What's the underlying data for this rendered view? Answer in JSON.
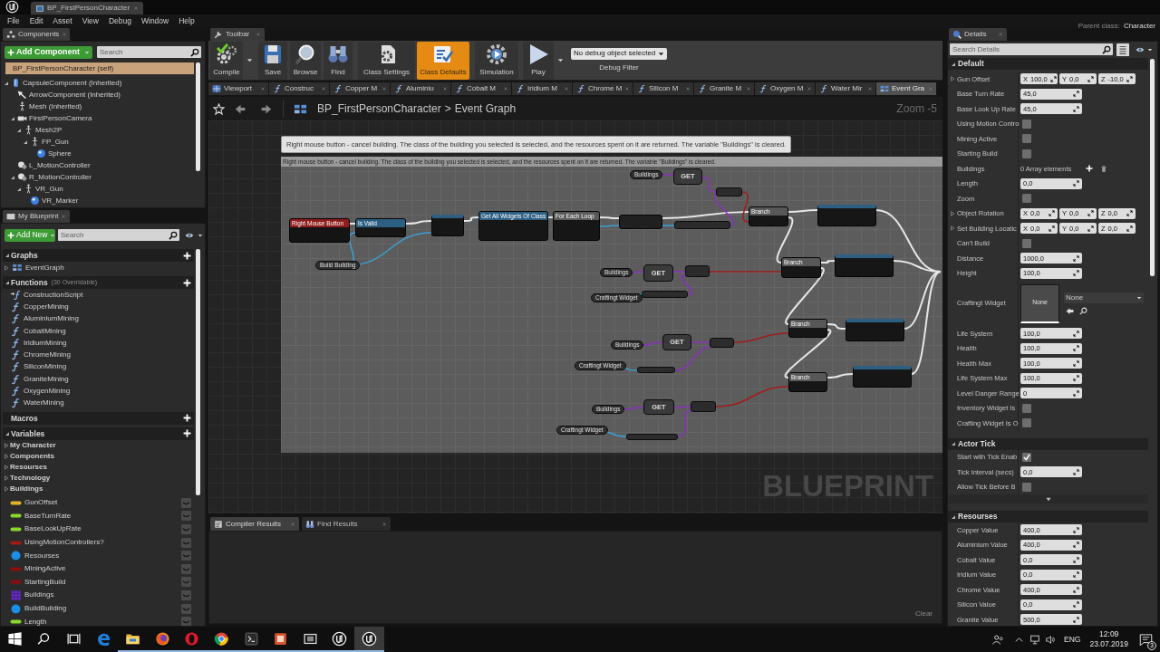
{
  "title_bar": {
    "document_tab": "BP_FirstPersonCharacter",
    "parent_class_label": "Parent class:",
    "parent_class": "Character"
  },
  "menu": [
    "File",
    "Edit",
    "Asset",
    "View",
    "Debug",
    "Window",
    "Help"
  ],
  "components": {
    "tab": "Components",
    "add_button": "Add Component",
    "search": {
      "placeholder": "Search"
    },
    "root": {
      "label": "BP_FirstPersonCharacter (self)",
      "selected": true
    },
    "tree": [
      {
        "label": "CapsuleComponent (Inherited)",
        "kind": "capsule",
        "expanded": true,
        "children": [
          {
            "label": "ArrowComponent (Inherited)",
            "kind": "arrow"
          },
          {
            "label": "Mesh (Inherited)",
            "kind": "mesh"
          },
          {
            "label": "FirstPersonCamera",
            "kind": "camera",
            "expanded": true,
            "children": [
              {
                "label": "Mesh2P",
                "kind": "mesh",
                "expanded": true,
                "children": [
                  {
                    "label": "FP_Gun",
                    "kind": "mesh",
                    "expanded": true,
                    "children": [
                      {
                        "label": "Sphere",
                        "kind": "sphere"
                      }
                    ]
                  }
                ]
              }
            ]
          },
          {
            "label": "L_MotionController",
            "kind": "controller"
          },
          {
            "label": "R_MotionController",
            "kind": "controller",
            "expanded": true,
            "children": [
              {
                "label": "VR_Gun",
                "kind": "mesh",
                "expanded": true,
                "children": [
                  {
                    "label": "VR_Marker",
                    "kind": "sphere"
                  }
                ]
              }
            ]
          }
        ]
      }
    ]
  },
  "my_blueprint": {
    "tab": "My Blueprint",
    "add_button": "Add New",
    "search": {
      "placeholder": "Search"
    },
    "sections": [
      {
        "title": "Graphs",
        "expanded": true,
        "items": [
          {
            "label": "EventGraph",
            "kind": "graph",
            "expanded": false
          }
        ]
      },
      {
        "title": "Functions",
        "note": "(30 Overridable)",
        "expanded": true,
        "items": [
          {
            "label": "ConstructionScript",
            "kind": "construction"
          },
          {
            "label": "CopperMining",
            "kind": "function"
          },
          {
            "label": "AluminiumMining",
            "kind": "function"
          },
          {
            "label": "CobaltMining",
            "kind": "function"
          },
          {
            "label": "IridiumMining",
            "kind": "function"
          },
          {
            "label": "ChromeMining",
            "kind": "function"
          },
          {
            "label": "SiliconMining",
            "kind": "function"
          },
          {
            "label": "GraniteMining",
            "kind": "function"
          },
          {
            "label": "OxygenMining",
            "kind": "function"
          },
          {
            "label": "WaterMining",
            "kind": "function"
          }
        ]
      },
      {
        "title": "Macros"
      },
      {
        "title": "Variables",
        "expanded": true,
        "categories": [
          {
            "label": "My Character",
            "expanded": false
          },
          {
            "label": "Components",
            "expanded": false
          },
          {
            "label": "Resourses",
            "expanded": false
          },
          {
            "label": "Technology",
            "expanded": false
          },
          {
            "label": "Buildings",
            "expanded": false
          }
        ],
        "items": [
          {
            "label": "GunOffset",
            "kind": "pill",
            "color": "#e2b42a"
          },
          {
            "label": "BaseTurnRate",
            "kind": "pill",
            "color": "#8ad82a"
          },
          {
            "label": "BaseLookUpRate",
            "kind": "pill",
            "color": "#8ad82a"
          },
          {
            "label": "UsingMotionControllers?",
            "kind": "pill",
            "color": "#a01818"
          },
          {
            "label": "Resourses",
            "kind": "ball",
            "color": "#1a8ee8"
          },
          {
            "label": "MiningActive",
            "kind": "pill",
            "color": "#8c0d0d"
          },
          {
            "label": "StartingBuild",
            "kind": "pill",
            "color": "#8c0d0d"
          },
          {
            "label": "Buildings",
            "kind": "grid",
            "color": "#6a26d9"
          },
          {
            "label": "BuildBuilding",
            "kind": "ball",
            "color": "#1a8ee8"
          },
          {
            "label": "Length",
            "kind": "pill",
            "color": "#8ad82a"
          }
        ]
      }
    ]
  },
  "toolbar": {
    "tab": "Toolbar",
    "buttons": [
      {
        "label": "Compile",
        "kind": "compile",
        "selected": false,
        "menu": true
      },
      {
        "label": "Save",
        "kind": "save",
        "selected": false,
        "menu": false
      },
      {
        "label": "Browse",
        "kind": "browse",
        "selected": false,
        "menu": false
      },
      {
        "label": "Find",
        "kind": "find",
        "selected": false,
        "menu": false
      },
      {
        "label": "Class Settings",
        "kind": "settings",
        "selected": false,
        "menu": false
      },
      {
        "label": "Class Defaults",
        "kind": "defaults",
        "selected": true,
        "menu": false
      },
      {
        "label": "Simulation",
        "kind": "simulation",
        "selected": false,
        "menu": false
      },
      {
        "label": "Play",
        "kind": "play",
        "selected": false,
        "menu": true
      }
    ],
    "debug_filter": {
      "value": "No debug object selected",
      "label": "Debug Filter"
    }
  },
  "document_tabs": [
    {
      "label": "Viewport",
      "kind": "viewport",
      "selected": false
    },
    {
      "label": "Construc",
      "kind": "function",
      "selected": false
    },
    {
      "label": "Copper M",
      "kind": "function",
      "selected": false
    },
    {
      "label": "Aluminiu",
      "kind": "function",
      "selected": false
    },
    {
      "label": "Cobalt M",
      "kind": "function",
      "selected": false
    },
    {
      "label": "Iridium M",
      "kind": "function",
      "selected": false
    },
    {
      "label": "Chrome M",
      "kind": "function",
      "selected": false
    },
    {
      "label": "Silicon M",
      "kind": "function",
      "selected": false
    },
    {
      "label": "Granite M",
      "kind": "function",
      "selected": false
    },
    {
      "label": "Oxygen M",
      "kind": "function",
      "selected": false
    },
    {
      "label": "Water Mir",
      "kind": "function",
      "selected": false
    },
    {
      "label": "Event Gra",
      "kind": "graph",
      "selected": true
    }
  ],
  "graph": {
    "breadcrumb": {
      "blueprint": "BP_FirstPersonCharacter",
      "separator": ">",
      "graph": "Event Graph",
      "zoom": "Zoom -5"
    },
    "tooltip": "Right mouse button - cancel building. The class of the building you selected is selected, and the resources spent on it are returned. The variable \"Buildings\" is cleared.",
    "comment": "Right mouse button - cancel building. The class of the building you selected is selected, and the resources spent on it are returned. The variable \"Buildings\" is cleared.",
    "nodes": [
      {
        "kind": "event",
        "title": "Right Mouse Button"
      },
      {
        "kind": "call",
        "title": "Is Valid"
      },
      {
        "kind": "call"
      },
      {
        "kind": "call",
        "title": "Get All Widgets Of Class"
      },
      {
        "kind": "macro",
        "title": "For Each Loop"
      },
      {
        "kind": "set"
      },
      {
        "kind": "pure"
      },
      {
        "kind": "variable",
        "title": "Buildings"
      },
      {
        "kind": "getter",
        "title": "GET"
      },
      {
        "kind": "pure"
      },
      {
        "kind": "branch",
        "title": "Branch"
      },
      {
        "kind": "call"
      },
      {
        "kind": "variable",
        "title": "Build Building"
      },
      {
        "kind": "variable",
        "title": "Buildings"
      },
      {
        "kind": "getter",
        "title": "GET"
      },
      {
        "kind": "pure"
      },
      {
        "kind": "variable",
        "title": "Craftingt Widget"
      },
      {
        "kind": "pure"
      },
      {
        "kind": "branch",
        "title": "Branch"
      },
      {
        "kind": "call"
      },
      {
        "kind": "branch",
        "title": "Branch"
      },
      {
        "kind": "call"
      },
      {
        "kind": "variable",
        "title": "Buildings"
      },
      {
        "kind": "getter",
        "title": "GET"
      },
      {
        "kind": "pure"
      },
      {
        "kind": "variable",
        "title": "Craftingt Widget"
      },
      {
        "kind": "pure"
      },
      {
        "kind": "branch",
        "title": "Branch"
      },
      {
        "kind": "call"
      },
      {
        "kind": "variable",
        "title": "Buildings"
      },
      {
        "kind": "getter",
        "title": "GET"
      },
      {
        "kind": "pure"
      },
      {
        "kind": "variable",
        "title": "Craftingt Widget"
      },
      {
        "kind": "pure"
      }
    ],
    "watermark": "BLUEPRINT"
  },
  "bottom_panel": {
    "tabs": [
      {
        "label": "Compiler Results",
        "kind": "log",
        "selected": true
      },
      {
        "label": "Find Results",
        "kind": "find",
        "selected": false
      }
    ],
    "clear_button": "Clear"
  },
  "details": {
    "tab": "Details",
    "search": {
      "placeholder": "Search Details"
    },
    "sections": [
      {
        "title": "Default",
        "expanded": true,
        "rows": [
          {
            "label": "Gun Offset",
            "kind": "vector",
            "expanded": false,
            "fields": [
              {
                "axis": "X",
                "value": "100,0"
              },
              {
                "axis": "Y",
                "value": "0,0"
              },
              {
                "axis": "Z",
                "value": "-10,0"
              }
            ]
          },
          {
            "label": "Base Turn Rate",
            "kind": "number",
            "value": "45,0"
          },
          {
            "label": "Base Look Up Rate",
            "kind": "number",
            "value": "45,0"
          },
          {
            "label": "Using Motion Contro",
            "kind": "checkbox",
            "checked": false
          },
          {
            "label": "Mining Active",
            "kind": "checkbox",
            "checked": false
          },
          {
            "label": "Starting Build",
            "kind": "checkbox",
            "checked": false
          },
          {
            "label": "Buildings",
            "kind": "array",
            "value": "0 Array elements"
          },
          {
            "label": "Length",
            "kind": "number",
            "value": "0,0"
          },
          {
            "label": "Zoom",
            "kind": "checkbox",
            "checked": false
          },
          {
            "label": "Object Rotation",
            "kind": "vector",
            "expanded": false,
            "fields": [
              {
                "axis": "X",
                "value": "0,0"
              },
              {
                "axis": "Y",
                "value": "0,0"
              },
              {
                "axis": "Z",
                "value": "0,0"
              }
            ]
          },
          {
            "label": "Set Building Locatic",
            "kind": "vector",
            "expanded": false,
            "fields": [
              {
                "axis": "X",
                "value": "0,0"
              },
              {
                "axis": "Y",
                "value": "0,0"
              },
              {
                "axis": "Z",
                "value": "0,0"
              }
            ]
          },
          {
            "label": "Can't Build",
            "kind": "checkbox",
            "checked": false
          },
          {
            "label": "Distance",
            "kind": "number",
            "value": "1000,0"
          },
          {
            "label": "Height",
            "kind": "number",
            "value": "100,0"
          },
          {
            "label": "Craftingt Widget",
            "kind": "asset",
            "thumbnail": "None",
            "value": "None"
          },
          {
            "label": "Life System",
            "kind": "number",
            "value": "100,0"
          },
          {
            "label": "Health",
            "kind": "number",
            "value": "100,0"
          },
          {
            "label": "Health Max",
            "kind": "number",
            "value": "100,0"
          },
          {
            "label": "Life System Max",
            "kind": "number",
            "value": "100,0"
          },
          {
            "label": "Level Danger Range",
            "kind": "number",
            "value": "0"
          },
          {
            "label": "Inventory Widget Is",
            "kind": "checkbox",
            "checked": false
          },
          {
            "label": "Crafting Widget Is O",
            "kind": "checkbox",
            "checked": false
          }
        ]
      },
      {
        "title": "Actor Tick",
        "expanded": true,
        "advanced": true,
        "rows": [
          {
            "label": "Start with Tick Enab",
            "kind": "checkbox",
            "checked": true
          },
          {
            "label": "Tick Interval (secs)",
            "kind": "number",
            "value": "0,0"
          },
          {
            "label": "Allow Tick Before B",
            "kind": "checkbox",
            "checked": false
          }
        ]
      },
      {
        "title": "Resourses",
        "expanded": true,
        "rows": [
          {
            "label": "Copper Value",
            "kind": "number",
            "value": "400,0"
          },
          {
            "label": "Aluminium Value",
            "kind": "number",
            "value": "400,0"
          },
          {
            "label": "Cobalt Value",
            "kind": "number",
            "value": "0,0"
          },
          {
            "label": "Iridium Value",
            "kind": "number",
            "value": "0,0"
          },
          {
            "label": "Chrome Value",
            "kind": "number",
            "value": "400,0"
          },
          {
            "label": "Silicon Value",
            "kind": "number",
            "value": "0,0"
          },
          {
            "label": "Granite Value",
            "kind": "number",
            "value": "500,0"
          }
        ]
      }
    ]
  },
  "taskbar": {
    "apps": [
      {
        "kind": "start",
        "running": false,
        "selected": false
      },
      {
        "kind": "search",
        "running": false,
        "selected": false
      },
      {
        "kind": "task-view",
        "running": false,
        "selected": false
      },
      {
        "kind": "edge",
        "running": false,
        "selected": false
      },
      {
        "kind": "explorer",
        "running": true,
        "selected": false
      },
      {
        "kind": "firefox",
        "running": true,
        "selected": false
      },
      {
        "kind": "opera",
        "running": true,
        "selected": false
      },
      {
        "kind": "chrome",
        "running": true,
        "selected": false
      },
      {
        "kind": "terminal",
        "running": true,
        "selected": false
      },
      {
        "kind": "tile",
        "running": true,
        "selected": false
      },
      {
        "kind": "frame",
        "running": true,
        "selected": false
      },
      {
        "kind": "engine",
        "running": true,
        "selected": false
      },
      {
        "kind": "engine",
        "running": true,
        "selected": true
      }
    ],
    "tray": {
      "language": "ENG",
      "time": "12:09",
      "date": "23.07.2019",
      "notifications": "3"
    }
  }
}
